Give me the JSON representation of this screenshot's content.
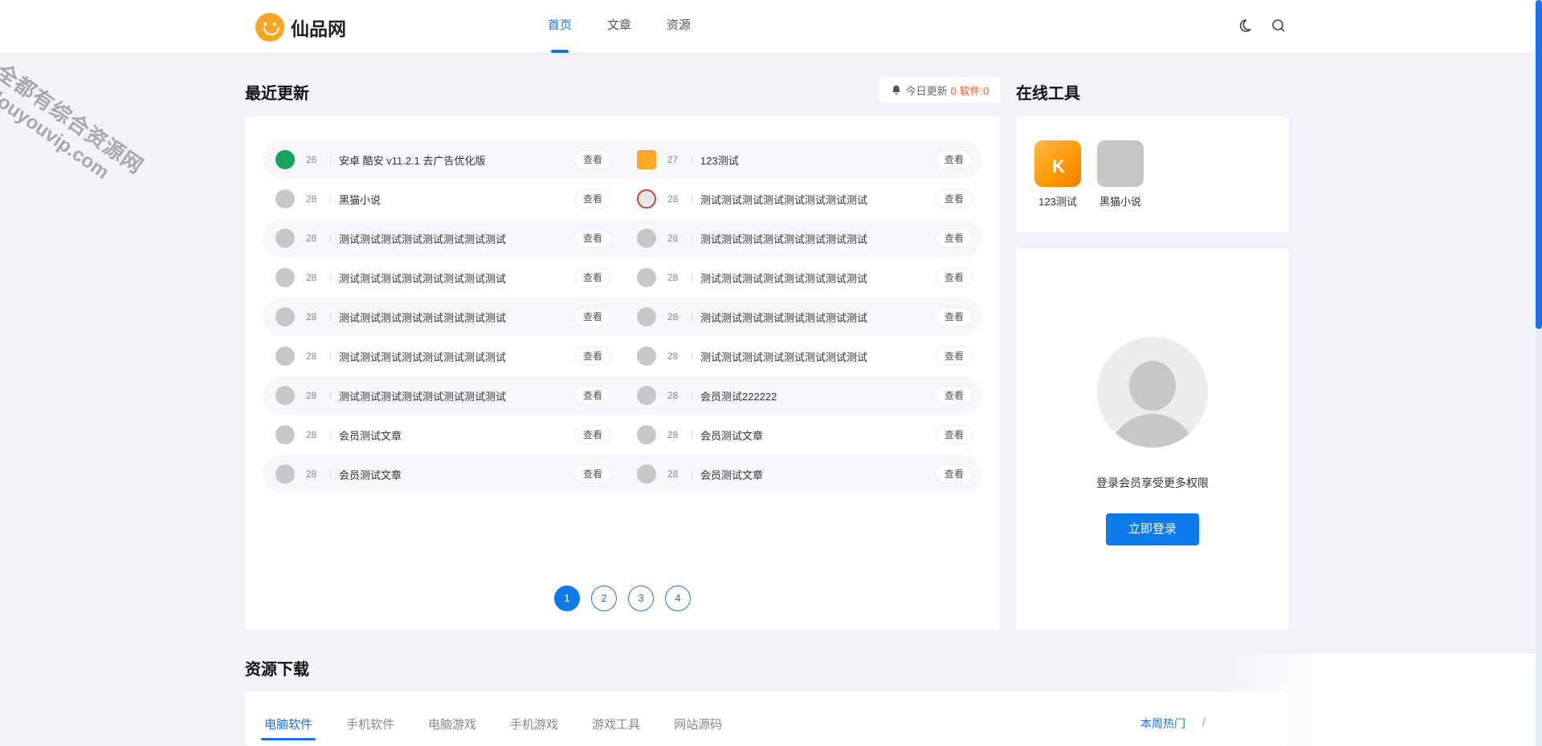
{
  "site": {
    "logo_text": "仙品网"
  },
  "nav": {
    "items": [
      "首页",
      "文章",
      "资源"
    ]
  },
  "watermark": {
    "line1": "全都有综合资源网",
    "line2": "douyouvip.com"
  },
  "latest": {
    "title": "最近更新",
    "today_label": "今日更新",
    "today_count": "0 软件:0",
    "view_label": "查看",
    "items": [
      {
        "count": "26",
        "title": "安卓 酷安 v11.2.1 去广告优化版"
      },
      {
        "count": "27",
        "title": "123测试"
      },
      {
        "count": "28",
        "title": "黑猫小说"
      },
      {
        "count": "28",
        "title": "测试测试测试测试测试测试测试测试"
      },
      {
        "count": "28",
        "title": "测试测试测试测试测试测试测试测试"
      },
      {
        "count": "28",
        "title": "测试测试测试测试测试测试测试测试"
      },
      {
        "count": "28",
        "title": "测试测试测试测试测试测试测试测试"
      },
      {
        "count": "28",
        "title": "测试测试测试测试测试测试测试测试"
      },
      {
        "count": "28",
        "title": "测试测试测试测试测试测试测试测试"
      },
      {
        "count": "28",
        "title": "测试测试测试测试测试测试测试测试"
      },
      {
        "count": "28",
        "title": "测试测试测试测试测试测试测试测试"
      },
      {
        "count": "28",
        "title": "测试测试测试测试测试测试测试测试"
      },
      {
        "count": "28",
        "title": "测试测试测试测试测试测试测试测试"
      },
      {
        "count": "28",
        "title": "会员测试222222"
      },
      {
        "count": "28",
        "title": "会员测试文章"
      },
      {
        "count": "28",
        "title": "会员测试文章"
      },
      {
        "count": "28",
        "title": "会员测试文章"
      },
      {
        "count": "28",
        "title": "会员测试文章"
      }
    ],
    "pages": [
      "1",
      "2",
      "3",
      "4"
    ]
  },
  "tools": {
    "title": "在线工具",
    "items": [
      {
        "label": "123测试",
        "icon": "kugou-icon"
      },
      {
        "label": "黑猫小说",
        "icon": "placeholder-icon"
      }
    ]
  },
  "login": {
    "tip": "登录会员享受更多权限",
    "button": "立即登录"
  },
  "resources": {
    "title": "资源下载",
    "tabs": [
      "电脑软件",
      "手机软件",
      "电脑游戏",
      "手机游戏",
      "游戏工具",
      "网站源码"
    ],
    "hot_label": "本周热门",
    "hot_sep": "/"
  },
  "colors": {
    "accent": "#1a73e8",
    "button": "#0d7bea",
    "highlight": "#ff5722"
  }
}
